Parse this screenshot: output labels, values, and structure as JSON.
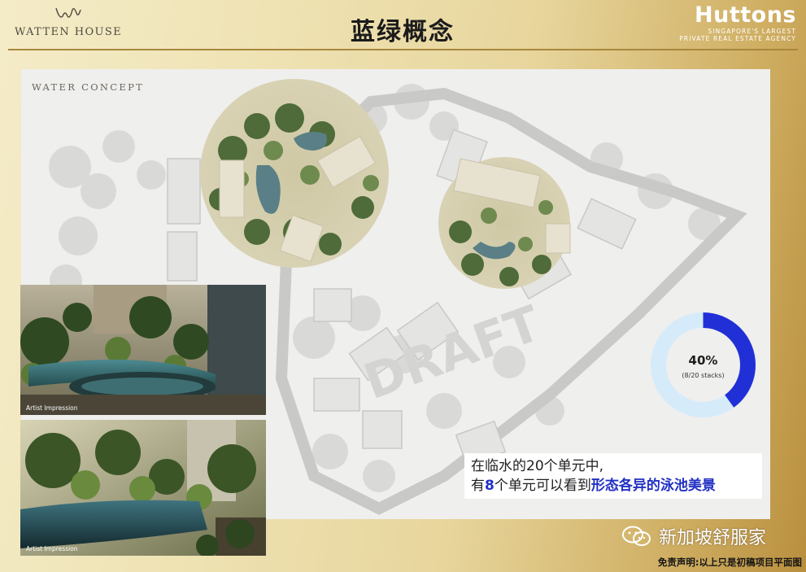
{
  "header": {
    "brand_name": "WATTEN HOUSE",
    "title": "蓝绿概念",
    "agency_name": "Huttons",
    "agency_tagline_1": "SINGAPORE'S LARGEST",
    "agency_tagline_2": "PRIVATE REAL ESTATE AGENCY"
  },
  "panel": {
    "label": "WATER CONCEPT",
    "watermark": "DRAFT"
  },
  "photos": [
    {
      "caption": "Artist Impression"
    },
    {
      "caption": "Artist Impression"
    }
  ],
  "donut": {
    "percent_label": "40%",
    "sub_label": "(8/20 stacks)",
    "fraction": 0.4,
    "fill_color": "#2130d6",
    "track_color": "#d6ebfa"
  },
  "callout": {
    "line1": "在临水的20个单元中,",
    "line2_prefix": "有",
    "line2_count": "8",
    "line2_middle": "个单元可以看到",
    "line2_highlight": "形态各异的泳池美景"
  },
  "footer": {
    "wechat_name": "新加坡舒服家",
    "disclaimer": "免责声明:以上只是初稿项目平面图"
  }
}
